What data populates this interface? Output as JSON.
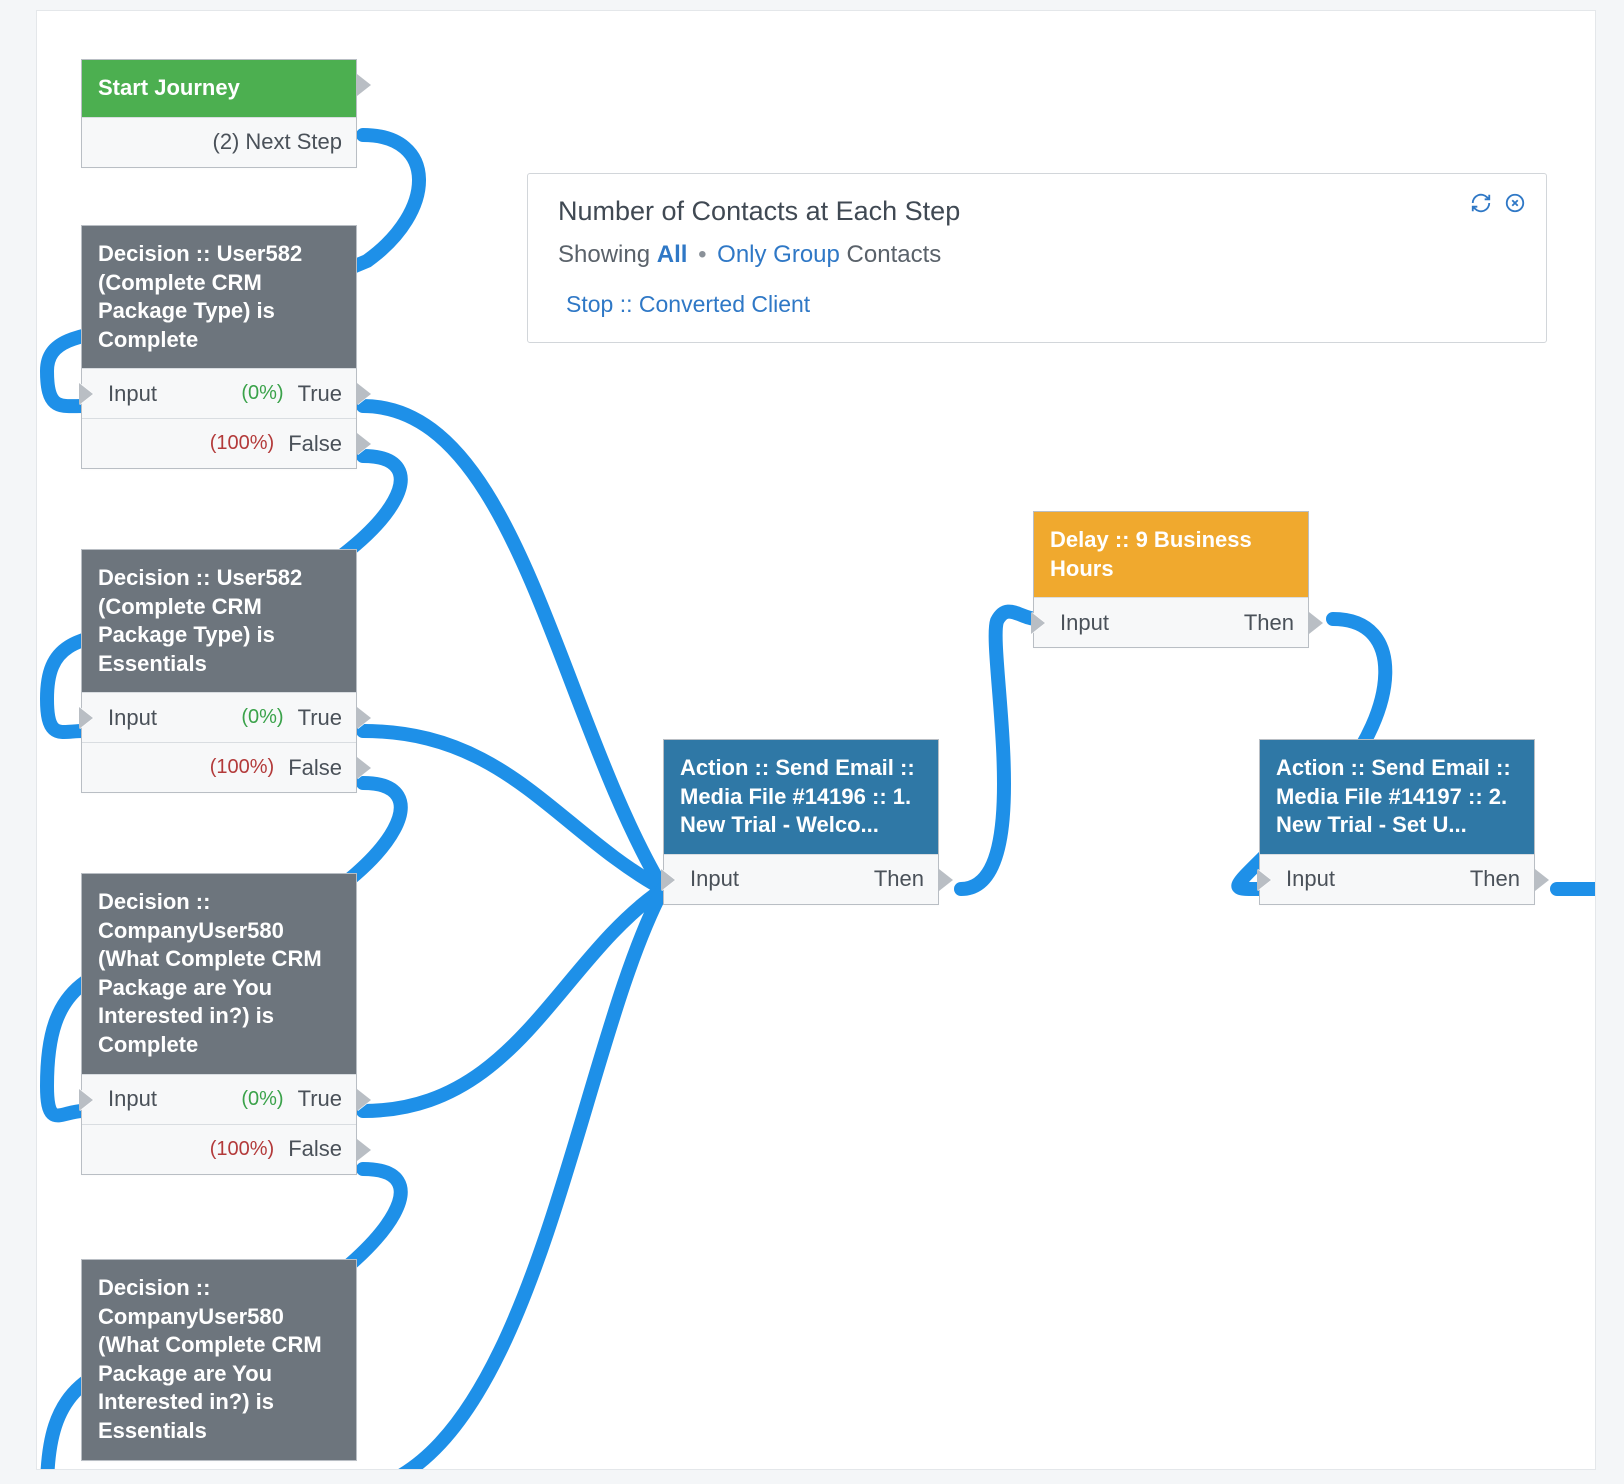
{
  "colors": {
    "connector": "#1e90e8",
    "green_head": "#4caf50",
    "gray_head": "#6d757d",
    "blue_head": "#2f78a6",
    "orange_head": "#f0a92e"
  },
  "info_panel": {
    "title": "Number of Contacts at Each Step",
    "showing_label": "Showing",
    "filter_all": "All",
    "filter_only_group": "Only Group",
    "filter_suffix": "Contacts",
    "breadcrumb": "Stop :: Converted Client",
    "refresh_icon": "refresh",
    "close_icon": "close"
  },
  "start": {
    "title": "Start Journey",
    "next_count": "(2)",
    "next_label": "Next Step"
  },
  "decision1": {
    "title": "Decision :: User582 (Complete CRM Package Type) is Complete",
    "input": "Input",
    "true_pct": "(0%)",
    "true": "True",
    "false_pct": "(100%)",
    "false": "False"
  },
  "decision2": {
    "title": "Decision :: User582 (Complete CRM Package Type) is Essentials",
    "input": "Input",
    "true_pct": "(0%)",
    "true": "True",
    "false_pct": "(100%)",
    "false": "False"
  },
  "decision3": {
    "title": "Decision :: CompanyUser580 (What Complete CRM Package are You Interested in?) is Complete",
    "input": "Input",
    "true_pct": "(0%)",
    "true": "True",
    "false_pct": "(100%)",
    "false": "False"
  },
  "decision4": {
    "title": "Decision :: CompanyUser580 (What Complete CRM Package are You Interested in?) is Essentials"
  },
  "action1": {
    "title": "Action :: Send Email :: Media File #14196 :: 1. New Trial - Welco...",
    "input": "Input",
    "then": "Then"
  },
  "delay1": {
    "title": "Delay :: 9 Business Hours",
    "input": "Input",
    "then": "Then"
  },
  "action2": {
    "title": "Action :: Send Email :: Media File #14197 :: 2. New Trial - Set U...",
    "input": "Input",
    "then": "Then"
  }
}
